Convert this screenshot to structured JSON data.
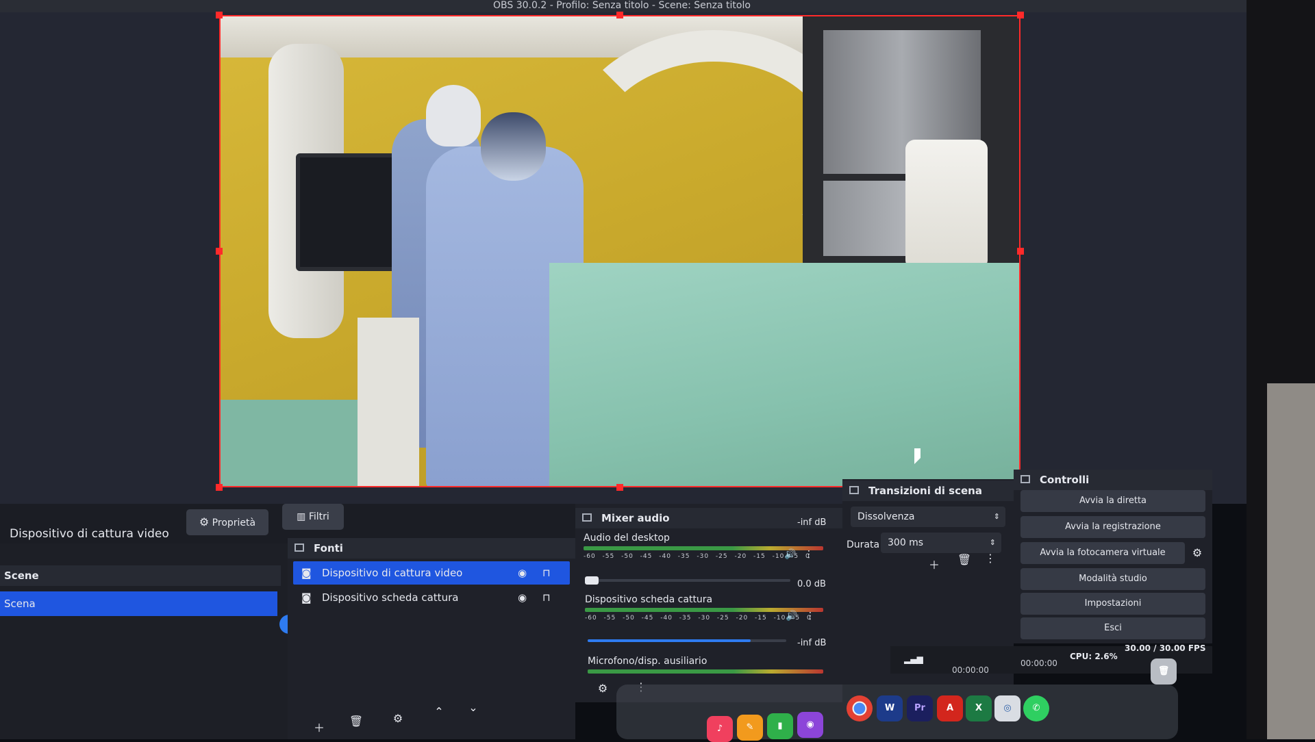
{
  "window": {
    "title": "OBS 30.0.2 - Profilo: Senza titolo - Scene: Senza titolo"
  },
  "source_toolbar": {
    "selected_source": "Dispositivo di cattura video",
    "properties_label": "Proprietà",
    "filters_label": "Filtri"
  },
  "scenes": {
    "title": "Scene",
    "items": [
      "Scena"
    ]
  },
  "sources": {
    "title": "Fonti",
    "items": [
      {
        "name": "Dispositivo di cattura video",
        "selected": true
      },
      {
        "name": "Dispositivo scheda cattura",
        "selected": false
      }
    ]
  },
  "mixer": {
    "title": "Mixer audio",
    "channels": [
      {
        "name": "Audio del desktop",
        "db": "-inf dB",
        "level": 0.02
      },
      {
        "name": "Dispositivo scheda cattura",
        "db": "0.0 dB",
        "level": 0.82
      },
      {
        "name": "Microfono/disp. ausiliario",
        "db": "-inf dB",
        "level": 0.0
      }
    ],
    "scale": "-60 -55 -50 -45 -40 -35 -30 -25 -20 -15 -10 -5 0"
  },
  "transitions": {
    "title": "Transizioni di scena",
    "type": "Dissolvenza",
    "duration_label": "Durata",
    "duration_value": "300 ms"
  },
  "controls": {
    "title": "Controlli",
    "buttons": [
      "Avvia la diretta",
      "Avvia la registrazione",
      "Avvia la fotocamera virtuale",
      "Modalità studio",
      "Impostazioni",
      "Esci"
    ]
  },
  "status": {
    "stream_time": "00:00:00",
    "rec_time": "00:00:00",
    "cpu": "CPU: 2.6%",
    "fps": "30.00 / 30.00 FPS"
  },
  "icons": {
    "gear": "gear-icon",
    "filter": "filter-icon",
    "eye": "eye-icon",
    "lock": "lock-icon",
    "camera": "camera-icon"
  },
  "colors": {
    "selection": "#1f56e0",
    "bounding_box": "#ff2a2a",
    "panel": "#1d1f26"
  }
}
